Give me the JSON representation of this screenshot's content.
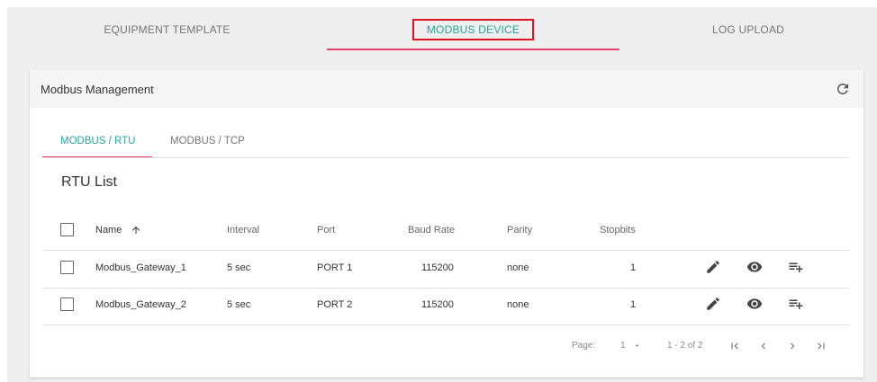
{
  "top_tabs": [
    {
      "label": "EQUIPMENT TEMPLATE"
    },
    {
      "label": "MODBUS DEVICE"
    },
    {
      "label": "LOG UPLOAD"
    }
  ],
  "card": {
    "title": "Modbus Management",
    "refresh_icon": "refresh-icon"
  },
  "sub_tabs": [
    {
      "label": "MODBUS / RTU"
    },
    {
      "label": "MODBUS / TCP"
    }
  ],
  "list_title": "RTU List",
  "columns": {
    "name": "Name",
    "interval": "Interval",
    "port": "Port",
    "baud_rate": "Baud Rate",
    "parity": "Parity",
    "stopbits": "Stopbits"
  },
  "rows": [
    {
      "name": "Modbus_Gateway_1",
      "interval": "5 sec",
      "port": "PORT 1",
      "baud_rate": "115200",
      "parity": "none",
      "stopbits": "1"
    },
    {
      "name": "Modbus_Gateway_2",
      "interval": "5 sec",
      "port": "PORT 2",
      "baud_rate": "115200",
      "parity": "none",
      "stopbits": "1"
    }
  ],
  "pagination": {
    "page_label": "Page:",
    "page_value": "1",
    "range": "1 - 2 of 2"
  },
  "colors": {
    "accent": "#26a69a",
    "ink": "#e8406a",
    "highlight_box": "#e0141e"
  }
}
